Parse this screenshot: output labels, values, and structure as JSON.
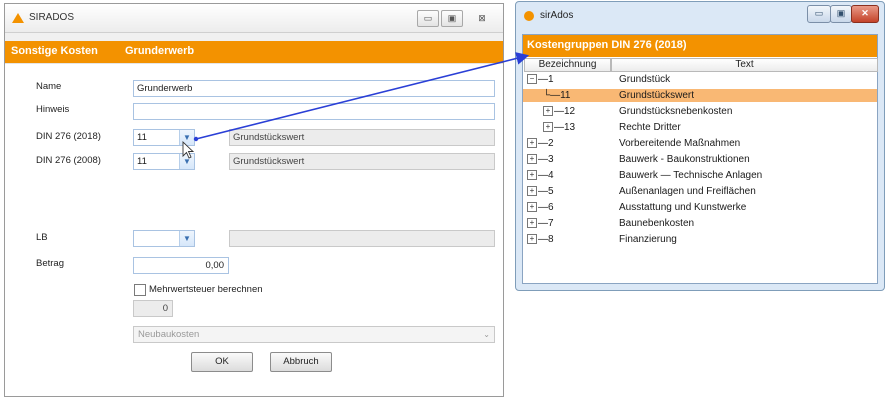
{
  "main_window": {
    "title": "SIRADOS",
    "controls": {
      "minimize": "▭",
      "maximize": "▣",
      "close": "⊠"
    },
    "header": {
      "left": "Sonstige Kosten",
      "right": "Grunderwerb"
    },
    "form": {
      "name_label": "Name",
      "name_value": "Grunderwerb",
      "hinweis_label": "Hinweis",
      "hinweis_value": "",
      "din2018_label": "DIN 276 (2018)",
      "din2018_code": "11",
      "din2018_text": "Grundstückswert",
      "din2008_label": "DIN 276 (2008)",
      "din2008_code": "11",
      "din2008_text": "Grundstückswert",
      "lb_label": "LB",
      "lb_code": "",
      "lb_text": "",
      "betrag_label": "Betrag",
      "betrag_value": "0,00",
      "mwst_label": "Mehrwertsteuer berechnen",
      "mwst_value": "0",
      "category_value": "Neubaukosten",
      "ok_label": "OK",
      "cancel_label": "Abbruch"
    }
  },
  "tree_window": {
    "title": "sirAdos",
    "header": "Kostengruppen DIN 276 (2018)",
    "columns": [
      "Bezeichnung",
      "Text"
    ],
    "rows": [
      {
        "code": "1",
        "text": "Grundstück",
        "level": 0,
        "expander": "minus",
        "selected": false
      },
      {
        "code": "11",
        "text": "Grundstückswert",
        "level": 1,
        "expander": "none",
        "selected": true
      },
      {
        "code": "12",
        "text": "Grundstücksnebenkosten",
        "level": 1,
        "expander": "plus",
        "selected": false
      },
      {
        "code": "13",
        "text": "Rechte Dritter",
        "level": 1,
        "expander": "plus",
        "selected": false
      },
      {
        "code": "2",
        "text": "Vorbereitende Maßnahmen",
        "level": 0,
        "expander": "plus",
        "selected": false
      },
      {
        "code": "3",
        "text": "Bauwerk - Baukonstruktionen",
        "level": 0,
        "expander": "plus",
        "selected": false
      },
      {
        "code": "4",
        "text": "Bauwerk — Technische Anlagen",
        "level": 0,
        "expander": "plus",
        "selected": false
      },
      {
        "code": "5",
        "text": "Außenanlagen und Freiflächen",
        "level": 0,
        "expander": "plus",
        "selected": false
      },
      {
        "code": "6",
        "text": "Ausstattung und Kunstwerke",
        "level": 0,
        "expander": "plus",
        "selected": false
      },
      {
        "code": "7",
        "text": "Baunebenkosten",
        "level": 0,
        "expander": "plus",
        "selected": false
      },
      {
        "code": "8",
        "text": "Finanzierung",
        "level": 0,
        "expander": "plus",
        "selected": false
      }
    ]
  },
  "colors": {
    "accent": "#f39200",
    "selection": "#f9b874",
    "arrow": "#2a3fd6"
  }
}
